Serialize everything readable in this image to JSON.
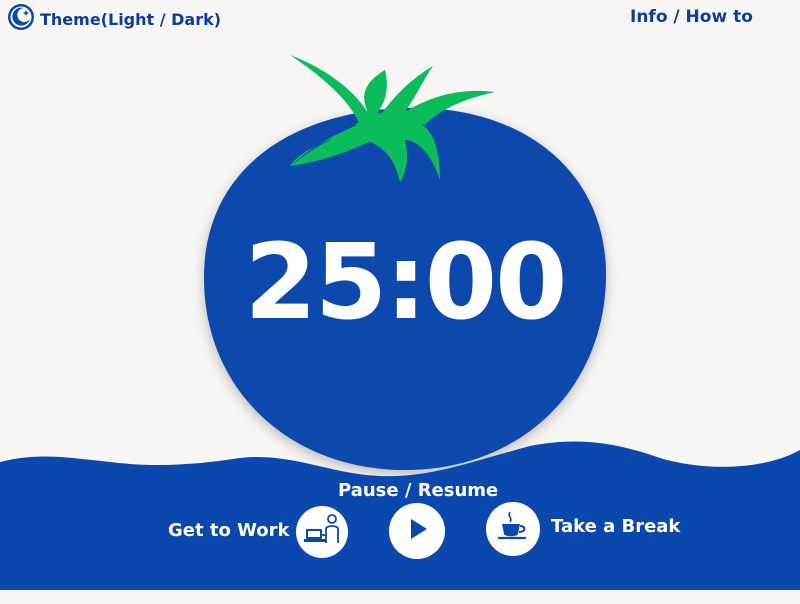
{
  "header": {
    "theme_label": "Theme(Light / Dark)",
    "info_label": "Info / How to"
  },
  "timer": {
    "display": "25:00"
  },
  "controls": {
    "pause_resume_label": "Pause / Resume",
    "work_label": "Get to Work",
    "break_label": "Take a Break",
    "work_icon": "person-laptop-icon",
    "play_icon": "play-icon",
    "break_icon": "coffee-cup-icon"
  },
  "colors": {
    "primary": "#0a48ad",
    "leaf": "#0cbc5a",
    "background": "#f7f6f4",
    "text_on_primary": "#ffffff"
  }
}
